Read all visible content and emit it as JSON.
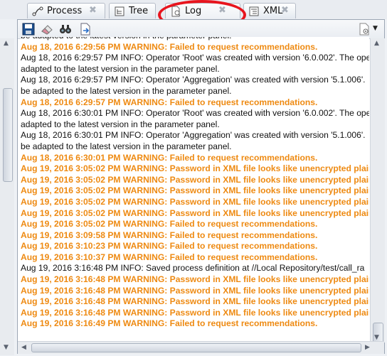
{
  "tabs": [
    {
      "label": "Process",
      "icon": "process-icon"
    },
    {
      "label": "Tree",
      "icon": "tree-icon"
    },
    {
      "label": "Log",
      "icon": "log-icon",
      "active": true
    },
    {
      "label": "XML",
      "icon": "xml-icon"
    }
  ],
  "close_glyph": "✖",
  "toolbar": {
    "icons": [
      "save-icon",
      "clear-icon",
      "search-icon",
      "export-icon",
      "settings-icon"
    ]
  },
  "colors": {
    "warning": "#ee8a12",
    "info": "#111111",
    "annotation": "#e8141d"
  },
  "log": {
    "lines": [
      {
        "level": "info",
        "text": "be adapted to the latest version in the parameter panel."
      },
      {
        "level": "warn",
        "text": "Aug 18, 2016 6:29:56 PM WARNING: Failed to request recommendations."
      },
      {
        "level": "info",
        "text": "Aug 18, 2016 6:29:57 PM INFO: Operator 'Root' was created with version '6.0.002'. The ope"
      },
      {
        "level": "info",
        "text": "adapted to the latest version in the parameter panel."
      },
      {
        "level": "info",
        "text": "Aug 18, 2016 6:29:57 PM INFO: Operator 'Aggregation' was created with version '5.1.006'. "
      },
      {
        "level": "info",
        "text": "be adapted to the latest version in the parameter panel."
      },
      {
        "level": "warn",
        "text": "Aug 18, 2016 6:29:57 PM WARNING: Failed to request recommendations."
      },
      {
        "level": "info",
        "text": "Aug 18, 2016 6:30:01 PM INFO: Operator 'Root' was created with version '6.0.002'. The ope"
      },
      {
        "level": "info",
        "text": "adapted to the latest version in the parameter panel."
      },
      {
        "level": "info",
        "text": "Aug 18, 2016 6:30:01 PM INFO: Operator 'Aggregation' was created with version '5.1.006'. "
      },
      {
        "level": "info",
        "text": "be adapted to the latest version in the parameter panel."
      },
      {
        "level": "warn",
        "text": "Aug 18, 2016 6:30:01 PM WARNING: Failed to request recommendations."
      },
      {
        "level": "warn",
        "text": "Aug 19, 2016 3:05:02 PM WARNING: Password in XML file looks like unencrypted plain t"
      },
      {
        "level": "warn",
        "text": "Aug 19, 2016 3:05:02 PM WARNING: Password in XML file looks like unencrypted plain t"
      },
      {
        "level": "warn",
        "text": "Aug 19, 2016 3:05:02 PM WARNING: Password in XML file looks like unencrypted plain t"
      },
      {
        "level": "warn",
        "text": "Aug 19, 2016 3:05:02 PM WARNING: Password in XML file looks like unencrypted plain t"
      },
      {
        "level": "warn",
        "text": "Aug 19, 2016 3:05:02 PM WARNING: Password in XML file looks like unencrypted plain t"
      },
      {
        "level": "warn",
        "text": "Aug 19, 2016 3:05:02 PM WARNING: Failed to request recommendations."
      },
      {
        "level": "warn",
        "text": "Aug 19, 2016 3:09:58 PM WARNING: Failed to request recommendations."
      },
      {
        "level": "warn",
        "text": "Aug 19, 2016 3:10:23 PM WARNING: Failed to request recommendations."
      },
      {
        "level": "warn",
        "text": "Aug 19, 2016 3:10:37 PM WARNING: Failed to request recommendations."
      },
      {
        "level": "info",
        "text": "Aug 19, 2016 3:16:48 PM INFO: Saved process definition at //Local Repository/test/call_ra"
      },
      {
        "level": "warn",
        "text": "Aug 19, 2016 3:16:48 PM WARNING: Password in XML file looks like unencrypted plain t"
      },
      {
        "level": "warn",
        "text": "Aug 19, 2016 3:16:48 PM WARNING: Password in XML file looks like unencrypted plain t"
      },
      {
        "level": "warn",
        "text": "Aug 19, 2016 3:16:48 PM WARNING: Password in XML file looks like unencrypted plain t"
      },
      {
        "level": "warn",
        "text": "Aug 19, 2016 3:16:48 PM WARNING: Password in XML file looks like unencrypted plain t"
      },
      {
        "level": "warn",
        "text": "Aug 19, 2016 3:16:49 PM WARNING: Failed to request recommendations."
      }
    ]
  }
}
